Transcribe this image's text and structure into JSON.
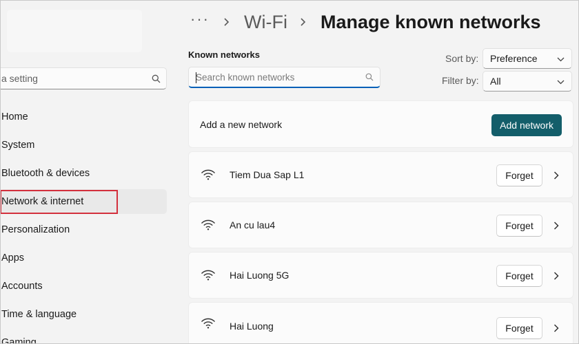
{
  "sidebar": {
    "search_placeholder": "a setting",
    "items": [
      {
        "label": "Home"
      },
      {
        "label": "System"
      },
      {
        "label": "Bluetooth & devices"
      },
      {
        "label": "Network & internet"
      },
      {
        "label": "Personalization"
      },
      {
        "label": "Apps"
      },
      {
        "label": "Accounts"
      },
      {
        "label": "Time & language"
      },
      {
        "label": "Gaming"
      }
    ],
    "selected_index": 3
  },
  "header": {
    "more": "···",
    "breadcrumb_parent": "Wi-Fi",
    "title": "Manage known networks"
  },
  "known": {
    "label": "Known networks",
    "search_placeholder": "Search known networks",
    "sort_label": "Sort by:",
    "sort_value": "Preference",
    "filter_label": "Filter by:",
    "filter_value": "All"
  },
  "add_network": {
    "text": "Add a new network",
    "button_label": "Add network"
  },
  "networks": [
    {
      "name": "Tiem Dua Sap L1",
      "forget_label": "Forget"
    },
    {
      "name": "An cu lau4",
      "forget_label": "Forget"
    },
    {
      "name": "Hai Luong 5G",
      "forget_label": "Forget"
    },
    {
      "name": "Hai Luong",
      "forget_label": "Forget"
    }
  ],
  "colors": {
    "accent": "#135e6a",
    "highlight": "#d32f3c",
    "focus": "#005fb8"
  }
}
